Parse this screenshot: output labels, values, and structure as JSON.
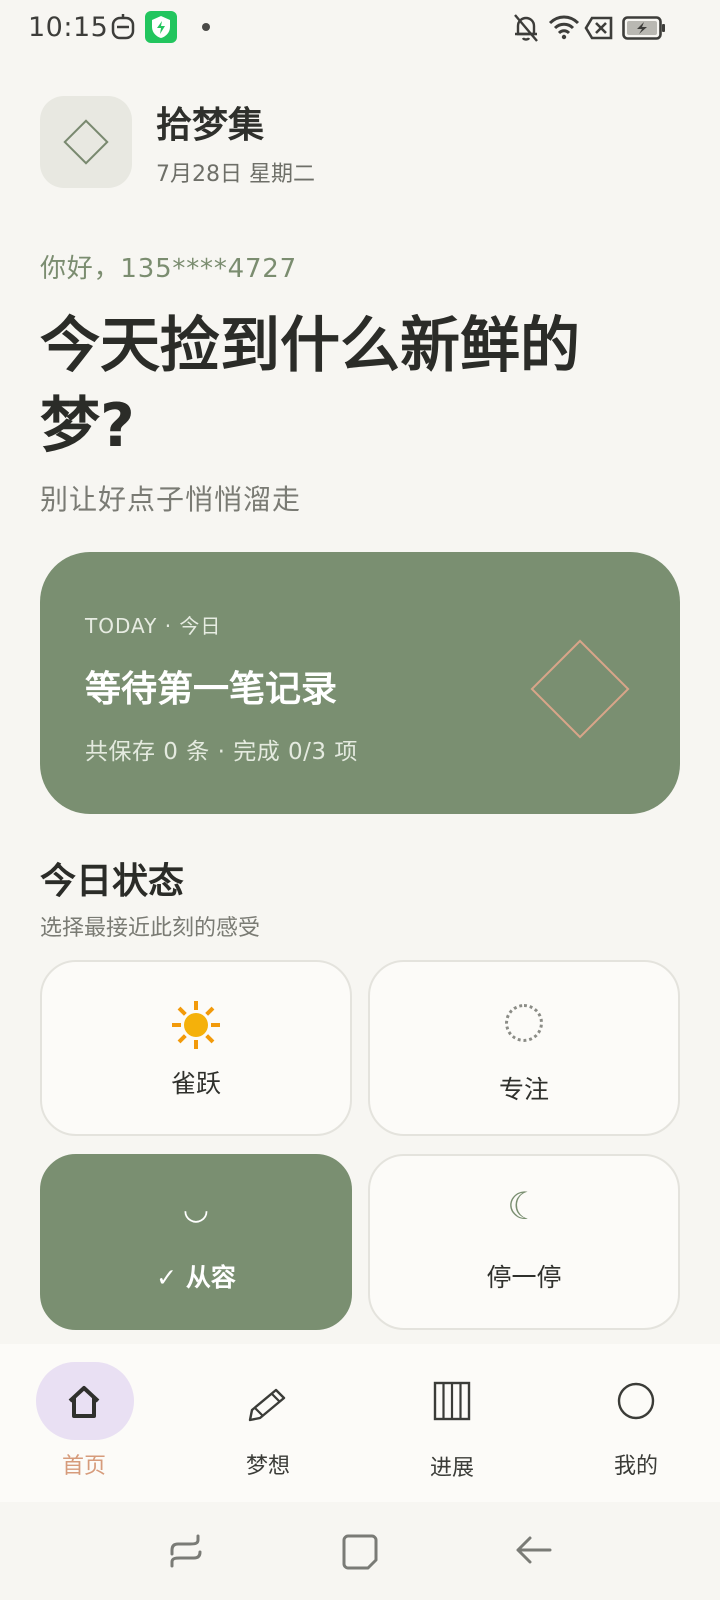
{
  "status_bar": {
    "time": "10:15",
    "left_icons": [
      "robot-icon",
      "shield-app-icon",
      "notification-dot"
    ],
    "right_icons": [
      "bell-off-icon",
      "wifi-icon",
      "no-sim-icon",
      "battery-charging-icon"
    ]
  },
  "header": {
    "app_name": "拾梦集",
    "date": "7月28日 星期二",
    "logo_icon": "diamond-icon"
  },
  "greeting": "你好，135****4727",
  "headline": "今天捡到什么新鲜的梦?",
  "subline": "别让好点子悄悄溜走",
  "today_card": {
    "eyebrow": "TODAY · 今日",
    "title": "等待第一笔记录",
    "meta": "共保存 0 条 · 完成 0/3 项",
    "icon": "diamond-outline-icon",
    "background": "#7a8f71"
  },
  "mood_section": {
    "title": "今日状态",
    "subtitle": "选择最接近此刻的感受",
    "options": [
      {
        "icon": "sun-icon",
        "label": "雀跃",
        "selected": false
      },
      {
        "icon": "dotted-circle-icon",
        "label": "专注",
        "selected": false
      },
      {
        "icon": "smile-icon",
        "glyph": "◡",
        "label": "✓ 从容",
        "selected": true
      },
      {
        "icon": "crescent-moon-icon",
        "glyph": "☾",
        "label": "停一停",
        "selected": false
      }
    ]
  },
  "bottom_nav": {
    "items": [
      {
        "icon": "home-icon",
        "label": "首页",
        "active": true
      },
      {
        "icon": "pencil-icon",
        "label": "梦想",
        "active": false
      },
      {
        "icon": "columns-icon",
        "label": "进展",
        "active": false
      },
      {
        "icon": "profile-circle-icon",
        "label": "我的",
        "active": false
      }
    ]
  },
  "colors": {
    "accent_green": "#7a8f71",
    "accent_peach": "#d69b7b",
    "active_pill": "#e9e0f3",
    "background": "#f7f6f2"
  }
}
